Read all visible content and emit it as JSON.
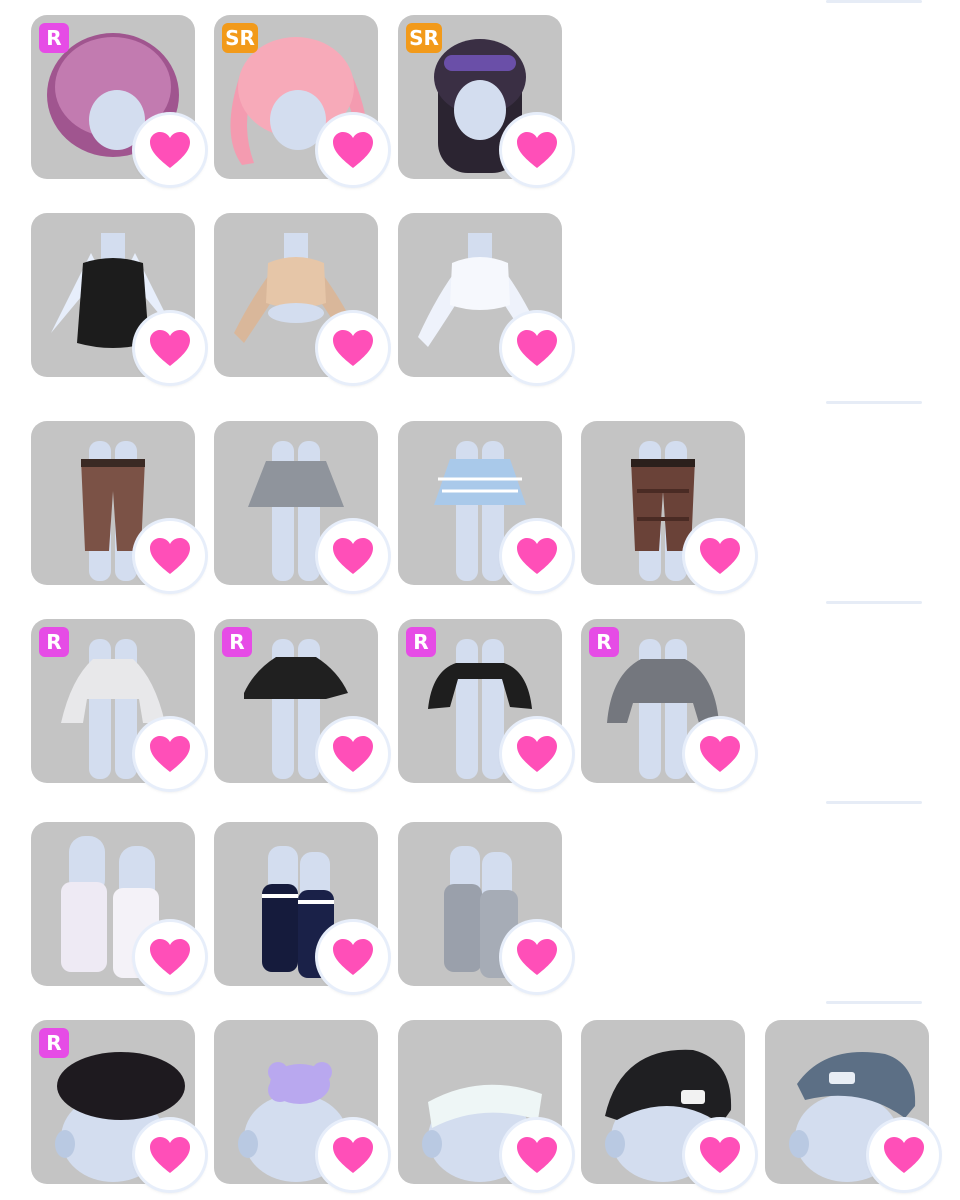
{
  "colors": {
    "card_bg": "#c4c4c4",
    "heart": "#ff4fb8",
    "rarity_r": "#e64ce6",
    "rarity_sr": "#f29a1a"
  },
  "rows": [
    {
      "category": "hair",
      "items": [
        {
          "rarity": "R",
          "art": "hair-purple-bob",
          "favorited": true
        },
        {
          "rarity": "SR",
          "art": "hair-pink-twintail",
          "favorited": true
        },
        {
          "rarity": "SR",
          "art": "hair-black-long",
          "favorited": true
        }
      ]
    },
    {
      "category": "tops",
      "items": [
        {
          "rarity": "",
          "art": "top-black-tank",
          "favorited": true
        },
        {
          "rarity": "",
          "art": "top-beige-cropped",
          "favorited": true
        },
        {
          "rarity": "",
          "art": "top-white-shirt",
          "favorited": true
        }
      ]
    },
    {
      "category": "bottoms",
      "items": [
        {
          "rarity": "",
          "art": "pants-brown",
          "favorited": true
        },
        {
          "rarity": "",
          "art": "skirt-gray",
          "favorited": true
        },
        {
          "rarity": "",
          "art": "skirt-blue-plaid",
          "favorited": true
        },
        {
          "rarity": "",
          "art": "pants-brown-plaid",
          "favorited": true
        }
      ]
    },
    {
      "category": "outerwear",
      "items": [
        {
          "rarity": "R",
          "art": "cardigan-white",
          "favorited": true
        },
        {
          "rarity": "R",
          "art": "jacket-black",
          "favorited": true
        },
        {
          "rarity": "R",
          "art": "bolero-black",
          "favorited": true
        },
        {
          "rarity": "R",
          "art": "sweater-gray",
          "favorited": true
        }
      ]
    },
    {
      "category": "socks",
      "items": [
        {
          "rarity": "",
          "art": "socks-white-plaid",
          "favorited": true
        },
        {
          "rarity": "",
          "art": "socks-navy-stripe",
          "favorited": true
        },
        {
          "rarity": "",
          "art": "socks-gray-plaid",
          "favorited": true
        }
      ]
    },
    {
      "category": "headwear",
      "items": [
        {
          "rarity": "R",
          "art": "beret-black",
          "favorited": true
        },
        {
          "rarity": "",
          "art": "bear-plush",
          "favorited": true
        },
        {
          "rarity": "",
          "art": "head-bandage",
          "favorited": true
        },
        {
          "rarity": "",
          "art": "beanie-black",
          "favorited": true
        },
        {
          "rarity": "",
          "art": "beanie-blue",
          "favorited": true
        }
      ]
    }
  ]
}
